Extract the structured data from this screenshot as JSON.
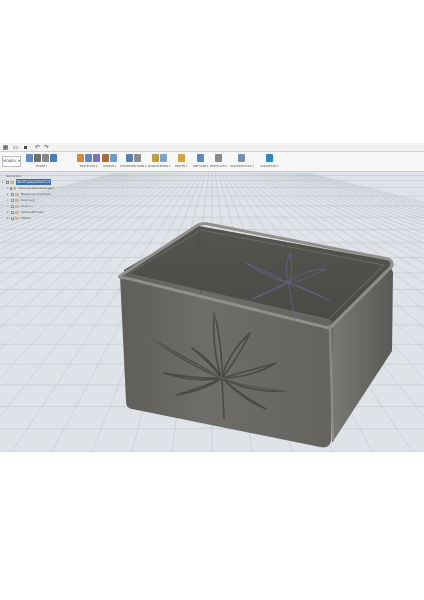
{
  "titlebar": {
    "icons": [
      "grid-icon",
      "file-icon",
      "save-icon",
      "undo-icon",
      "redo-icon"
    ]
  },
  "toolbar": {
    "workspace_label": "MODELL ▾",
    "groups": [
      {
        "id": "skizze",
        "label": "SKIZZE ▾",
        "colors": [
          "#5b8cc9",
          "#6f6f6f",
          "#8a8a8a",
          "#4a7fbf"
        ]
      },
      {
        "id": "erstellen",
        "label": "ERSTELLEN ▾",
        "colors": [
          "#d08a3a",
          "#5a88c8",
          "#7d6fb8"
        ]
      },
      {
        "id": "ändern",
        "label": "ÄNDERN ▾",
        "colors": [
          "#a86c3c",
          "#6b9bd1"
        ]
      },
      {
        "id": "zusammenfügen",
        "label": "ZUSAMMENFÜGEN ▾",
        "colors": [
          "#5b7fa8",
          "#8b8b8b"
        ]
      },
      {
        "id": "konstruieren",
        "label": "KONSTRUIEREN ▾",
        "colors": [
          "#c59b3b",
          "#7ba3d0"
        ]
      },
      {
        "id": "prüfen",
        "label": "PRÜFEN ▾",
        "colors": [
          "#d0a441"
        ]
      },
      {
        "id": "einfügen",
        "label": "EINFÜGEN ▾",
        "colors": [
          "#5c89bf"
        ]
      },
      {
        "id": "erstellen2",
        "label": "ERSTELLEN ▾",
        "colors": [
          "#8a8a8a"
        ]
      },
      {
        "id": "zusatzmodule",
        "label": "ZUSATZMODULE ▾",
        "colors": [
          "#7390b3"
        ]
      },
      {
        "id": "auswählen",
        "label": "AUSWÄHLEN ▾",
        "colors": [
          "#2b88c8"
        ]
      }
    ]
  },
  "browser": {
    "title": "BROWSER",
    "items": [
      {
        "label": "(Nicht gespeichert) v1",
        "active": true,
        "level": 0
      },
      {
        "label": "Dokumenteinstellungen",
        "level": 1
      },
      {
        "label": "Benannte Ansichten",
        "level": 1
      },
      {
        "label": "Ursprung",
        "level": 1
      },
      {
        "label": "Skizzen",
        "level": 1
      },
      {
        "label": "Konstruktionen",
        "level": 1
      },
      {
        "label": "Körper",
        "level": 1
      }
    ]
  },
  "colors": {
    "canvas_bg": "#dfe3e8",
    "grid": "#b9c0c8",
    "model_face": "#6b6a67",
    "model_rim": "#8f8e8a",
    "model_inner": "#545350"
  }
}
